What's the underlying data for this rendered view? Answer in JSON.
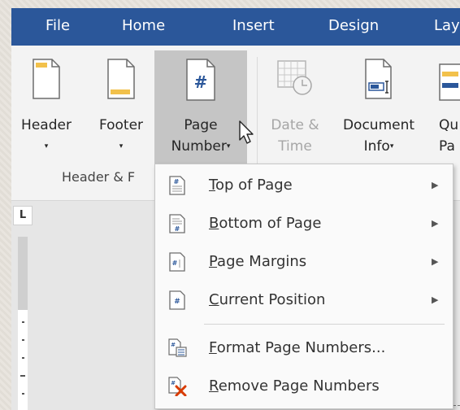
{
  "tabs": [
    {
      "label": "File"
    },
    {
      "label": "Home"
    },
    {
      "label": "Insert"
    },
    {
      "label": "Design"
    },
    {
      "label": "Lay"
    }
  ],
  "ribbon": {
    "header": {
      "label": "Header",
      "caret": "▾"
    },
    "footer": {
      "label": "Footer",
      "caret": "▾"
    },
    "page_number": {
      "line1": "Page",
      "line2": "Number",
      "caret": "▾",
      "icon_glyph": "#"
    },
    "date_time": {
      "line1": "Date &",
      "line2": "Time"
    },
    "document_info": {
      "line1": "Document",
      "line2": "Info",
      "caret": "▾"
    },
    "quick_parts": {
      "line1": "Qu",
      "line2": "Pa"
    },
    "group_label": "Header & F"
  },
  "ruler": {
    "corner": "L"
  },
  "menu": {
    "items": [
      {
        "accel": "T",
        "rest": "op of Page",
        "arrow": "▶"
      },
      {
        "accel": "B",
        "rest": "ottom of Page",
        "arrow": "▶"
      },
      {
        "accel": "P",
        "rest": "age Margins",
        "arrow": "▶"
      },
      {
        "accel": "C",
        "rest": "urrent Position",
        "arrow": "▶"
      },
      {
        "accel": "F",
        "rest": "ormat Page Numbers..."
      },
      {
        "accel": "R",
        "rest": "emove Page Numbers"
      }
    ]
  },
  "colors": {
    "ribbon_blue": "#2b579a",
    "header_icon_yellow": "#f2c14b",
    "page_number_icon_blue": "#2b579a",
    "remove_icon_red": "#d83b01"
  }
}
